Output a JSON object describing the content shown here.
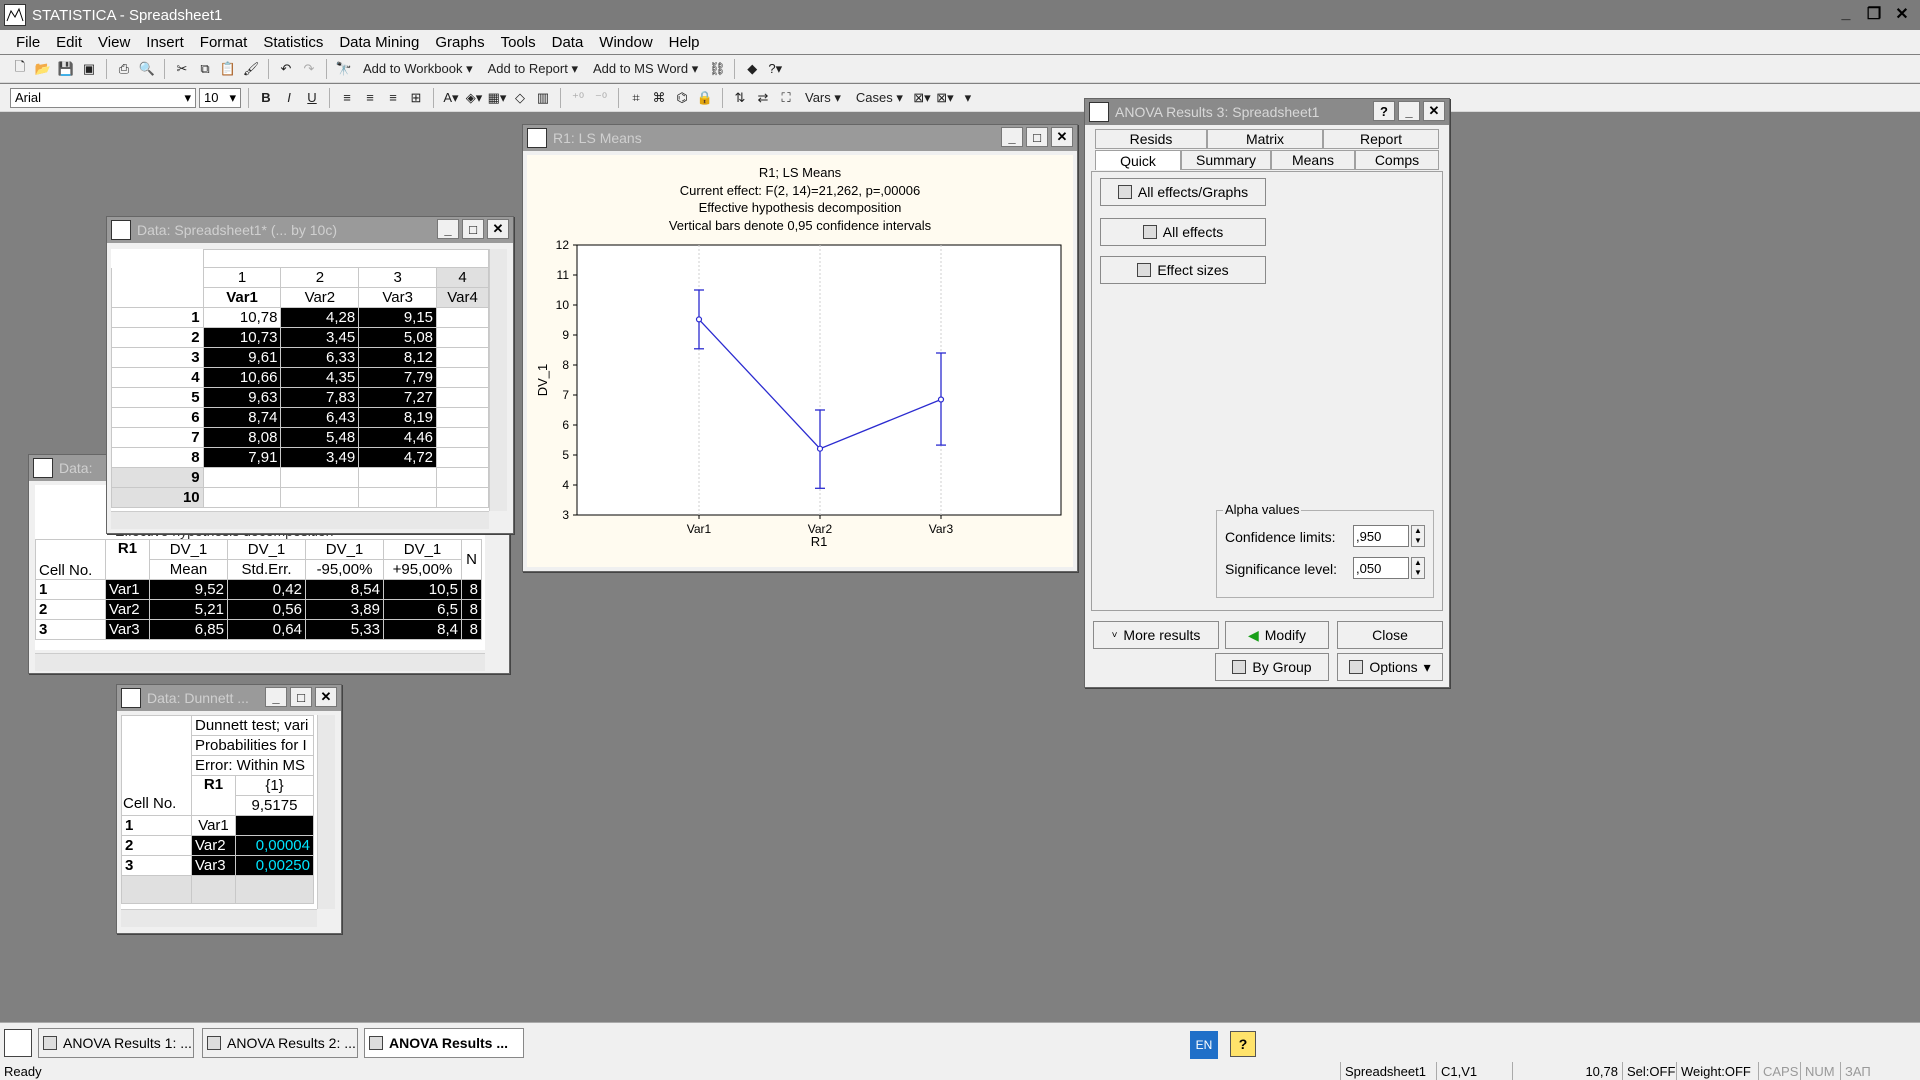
{
  "app": {
    "title": "STATISTICA - Spreadsheet1"
  },
  "menu": [
    "File",
    "Edit",
    "View",
    "Insert",
    "Format",
    "Statistics",
    "Data Mining",
    "Graphs",
    "Tools",
    "Data",
    "Window",
    "Help"
  ],
  "toolbar1": {
    "add_workbook": "Add to Workbook",
    "add_report": "Add to Report",
    "add_msword": "Add to MS Word"
  },
  "toolbar2": {
    "font": "Arial",
    "size": "10",
    "vars": "Vars",
    "cases": "Cases"
  },
  "data_win": {
    "title": "Data: Spreadsheet1* (... by 10c)",
    "col_nums": [
      "1",
      "2",
      "3",
      "4"
    ],
    "col_names": [
      "Var1",
      "Var2",
      "Var3",
      "Var4"
    ],
    "rows": [
      [
        "1",
        "10,78",
        "4,28",
        "9,15"
      ],
      [
        "2",
        "10,73",
        "3,45",
        "5,08"
      ],
      [
        "3",
        "9,61",
        "6,33",
        "8,12"
      ],
      [
        "4",
        "10,66",
        "4,35",
        "7,79"
      ],
      [
        "5",
        "9,63",
        "7,83",
        "7,27"
      ],
      [
        "6",
        "8,74",
        "6,43",
        "8,19"
      ],
      [
        "7",
        "8,08",
        "5,48",
        "4,46"
      ],
      [
        "8",
        "7,91",
        "3,49",
        "4,72"
      ]
    ],
    "empty_rows": [
      "9",
      "10"
    ]
  },
  "means_win": {
    "title": "Data:",
    "partial_caption": "Effective hypothesis decomposition",
    "cell_no": "Cell No.",
    "headers": [
      [
        "R1",
        ""
      ],
      [
        "DV_1",
        "Mean"
      ],
      [
        "DV_1",
        "Std.Err."
      ],
      [
        "DV_1",
        "-95,00%"
      ],
      [
        "DV_1",
        "+95,00%"
      ],
      [
        "N",
        ""
      ]
    ],
    "rows": [
      [
        "1",
        "Var1",
        "9,52",
        "0,42",
        "8,54",
        "10,5",
        "8"
      ],
      [
        "2",
        "Var2",
        "5,21",
        "0,56",
        "3,89",
        "6,5",
        "8"
      ],
      [
        "3",
        "Var3",
        "6,85",
        "0,64",
        "5,33",
        "8,4",
        "8"
      ]
    ]
  },
  "dunnett_win": {
    "title": "Data: Dunnett ...",
    "lines": [
      "Dunnett test; vari",
      "Probabilities for I",
      "Error: Within MS"
    ],
    "cell_no": "Cell No.",
    "h_r1": "R1",
    "h_c1": "{1}",
    "h_c2": "9,5175",
    "rows": [
      [
        "1",
        "Var1",
        ""
      ],
      [
        "2",
        "Var2",
        "0,00004"
      ],
      [
        "3",
        "Var3",
        "0,00250"
      ]
    ]
  },
  "graph_win": {
    "title": "R1: LS Means"
  },
  "chart_data": {
    "type": "line",
    "title": "R1; LS Means",
    "subtitle": [
      "Current effect: F(2, 14)=21,262, p=,00006",
      "Effective hypothesis decomposition",
      "Vertical bars denote 0,95 confidence intervals"
    ],
    "xlabel": "R1",
    "ylabel": "DV_1",
    "categories": [
      "Var1",
      "Var2",
      "Var3"
    ],
    "values": [
      9.52,
      5.21,
      6.85
    ],
    "lower": [
      8.54,
      3.89,
      5.33
    ],
    "upper": [
      10.5,
      6.5,
      8.4
    ],
    "ylim": [
      3,
      12
    ],
    "yticks": [
      "3",
      "4",
      "5",
      "6",
      "7",
      "8",
      "9",
      "10",
      "11",
      "12"
    ],
    "grid": true,
    "color": "#2b2bd0"
  },
  "anova_win": {
    "title": "ANOVA Results 3: Spreadsheet1",
    "tabs_top": [
      "Resids",
      "Matrix",
      "Report"
    ],
    "tabs_bottom": [
      "Quick",
      "Summary",
      "Means",
      "Comps"
    ],
    "btn_all_graphs": "All effects/Graphs",
    "btn_all_effects": "All effects",
    "btn_effect_sizes": "Effect sizes",
    "alpha_group": "Alpha values",
    "conf_label": "Confidence limits:",
    "conf_value": ",950",
    "sig_label": "Significance level:",
    "sig_value": ",050",
    "btn_more": "More results",
    "btn_modify": "Modify",
    "btn_close": "Close",
    "btn_bygroup": "By Group",
    "btn_options": "Options"
  },
  "taskbar": [
    "ANOVA Results 1: ...",
    "ANOVA Results 2: ...",
    "ANOVA Results ..."
  ],
  "status": {
    "ready": "Ready",
    "lang": "EN",
    "sheet": "Spreadsheet1",
    "cell": "C1,V1",
    "value": "10,78",
    "sel": "Sel:OFF",
    "weight": "Weight:OFF",
    "caps": "CAPS",
    "num": "NUM",
    "zap": "ЗАП"
  }
}
